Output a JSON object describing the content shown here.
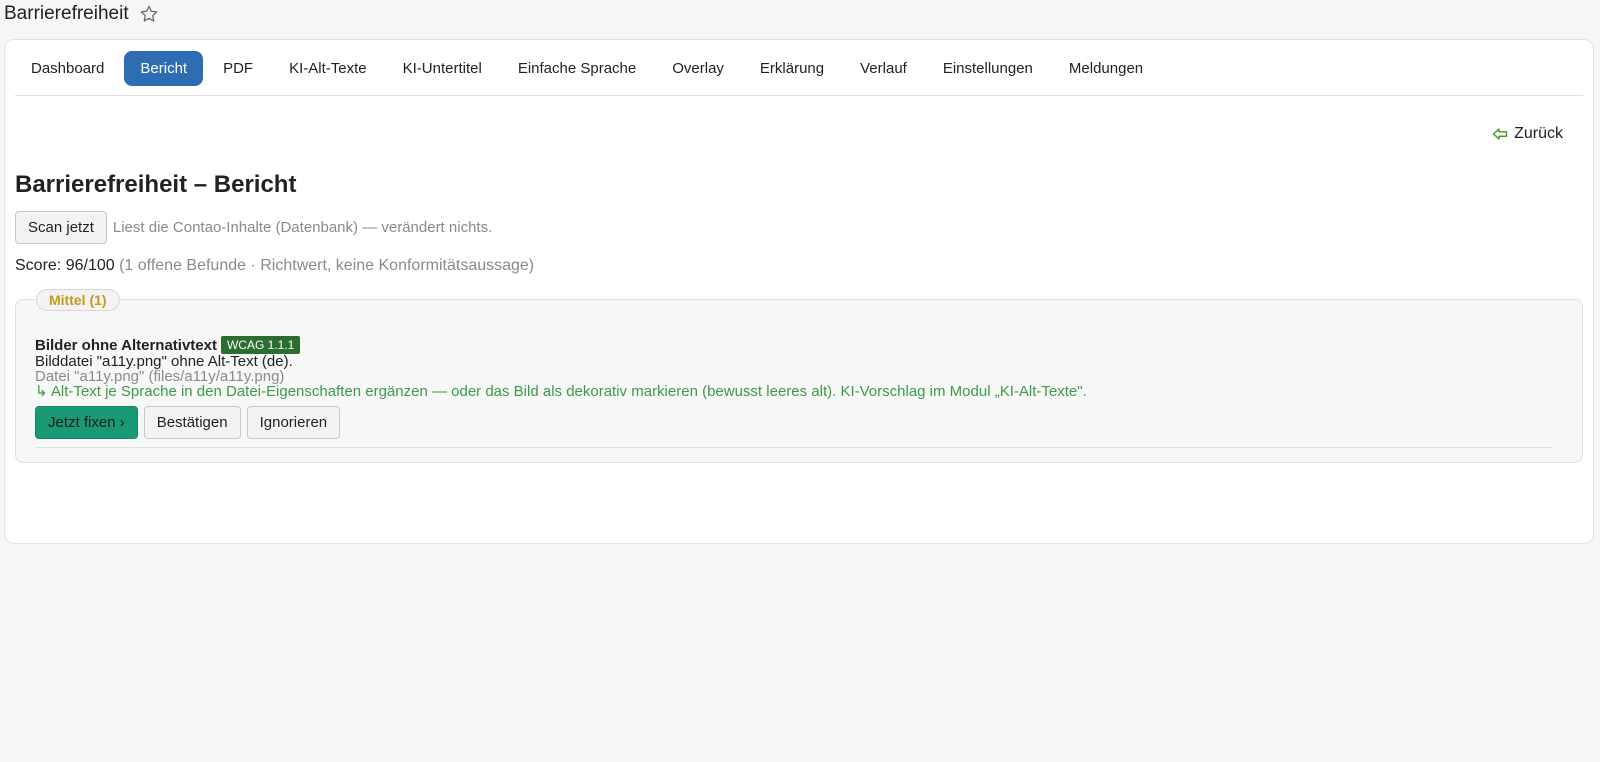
{
  "page": {
    "title": "Barrierefreiheit",
    "favorite_icon": "star-outline-icon"
  },
  "tabs": [
    {
      "label": "Dashboard",
      "active": false
    },
    {
      "label": "Bericht",
      "active": true
    },
    {
      "label": "PDF",
      "active": false
    },
    {
      "label": "KI-Alt-Texte",
      "active": false
    },
    {
      "label": "KI-Untertitel",
      "active": false
    },
    {
      "label": "Einfache Sprache",
      "active": false
    },
    {
      "label": "Overlay",
      "active": false
    },
    {
      "label": "Erklärung",
      "active": false
    },
    {
      "label": "Verlauf",
      "active": false
    },
    {
      "label": "Einstellungen",
      "active": false
    },
    {
      "label": "Meldungen",
      "active": false
    }
  ],
  "back": {
    "label": "Zurück",
    "icon": "arrow-left-outline-icon"
  },
  "report": {
    "title": "Barrierefreiheit – Bericht",
    "scan_button": "Scan jetzt",
    "scan_hint": "Liest die Contao-Inhalte (Datenbank) — verändert nichts.",
    "score_label": "Score:",
    "score_value": "96/100",
    "score_note": "(1 offene Befunde · Richtwert, keine Konformitätsaussage)"
  },
  "groups": [
    {
      "label": "Mittel (1)",
      "findings": [
        {
          "title": "Bilder ohne Alternativtext",
          "badge": "WCAG 1.1.1",
          "description": "Bilddatei \"a11y.png\" ohne Alt-Text (de).",
          "path": "Datei \"a11y.png\" (files/a11y/a11y.png)",
          "advice": "↳ Alt-Text je Sprache in den Datei-Eigenschaften ergänzen — oder das Bild als dekorativ markieren (bewusst leeres alt). KI-Vorschlag im Modul „KI-Alt-Texte\".",
          "actions": {
            "fix": "Jetzt fixen ›",
            "confirm": "Bestätigen",
            "ignore": "Ignorieren"
          }
        }
      ]
    }
  ],
  "colors": {
    "accent": "#2e6db3",
    "primary_button": "#1a9a74",
    "badge": "#2b6e32",
    "severity_medium": "#c8961a",
    "advice": "#3d9a4a"
  }
}
